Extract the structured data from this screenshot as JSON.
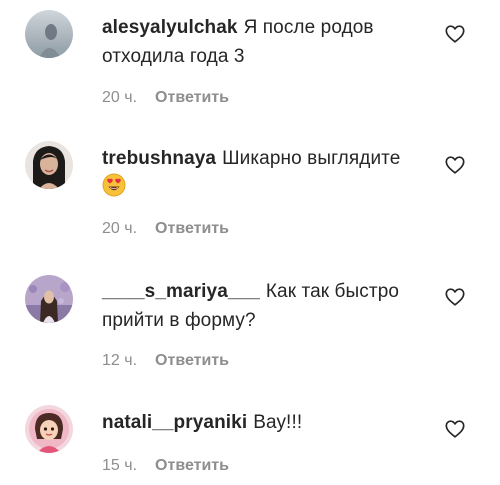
{
  "comments": [
    {
      "username": "alesyalyulchak",
      "text": "Я после родов отходила года 3",
      "time": "20 ч.",
      "reply_label": "Ответить",
      "avatar_icon": "avatar-photo-icon"
    },
    {
      "username": "trebushnaya",
      "text": "Шикарно выглядите",
      "emoji": "heart-eyes-emoji",
      "time": "20 ч.",
      "reply_label": "Ответить",
      "avatar_icon": "avatar-photo-icon"
    },
    {
      "username": "____s_mariya___",
      "text": "Как так быстро прийти в форму?",
      "time": "12 ч.",
      "reply_label": "Ответить",
      "avatar_icon": "avatar-photo-icon"
    },
    {
      "username": "natali__pryaniki",
      "text": "Вау!!!",
      "time": "15 ч.",
      "reply_label": "Ответить",
      "avatar_icon": "avatar-photo-icon"
    }
  ],
  "colors": {
    "text": "#262626",
    "meta": "#8e8e8e",
    "background": "#ffffff"
  },
  "icons": {
    "like": "heart-outline-icon"
  }
}
